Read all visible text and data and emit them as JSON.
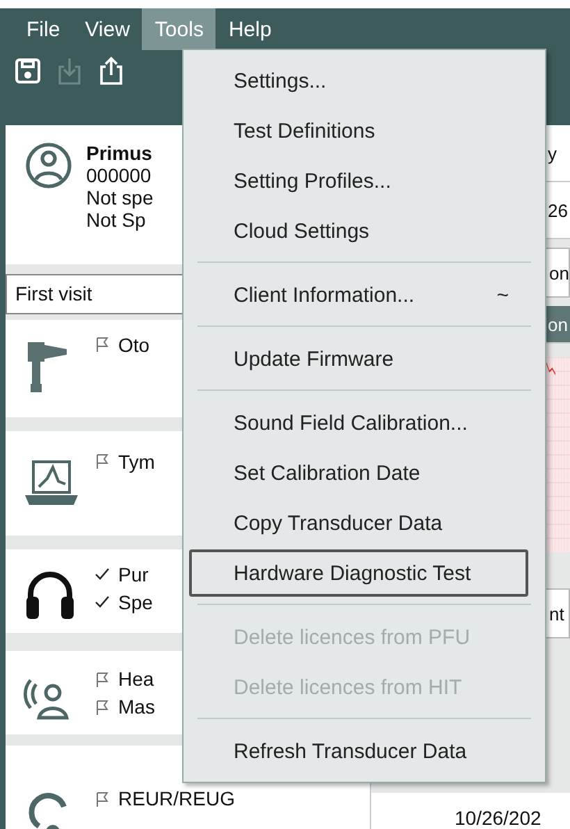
{
  "menubar": [
    {
      "label": "File",
      "selected": false
    },
    {
      "label": "View",
      "selected": false
    },
    {
      "label": "Tools",
      "selected": true
    },
    {
      "label": "Help",
      "selected": false
    }
  ],
  "toolbar": [
    {
      "kind": "save",
      "disabled": false
    },
    {
      "kind": "import",
      "disabled": true
    },
    {
      "kind": "export",
      "disabled": false
    }
  ],
  "client": {
    "name": "Primus",
    "id": "000000",
    "line_3": "Not spe",
    "line_4": "Not Sp"
  },
  "visit": {
    "value": "First visit"
  },
  "tests": [
    {
      "kind": "otoscope",
      "items": [
        {
          "label": "Oto",
          "done": false
        }
      ]
    },
    {
      "kind": "tympanometer",
      "items": [
        {
          "label": "Tym",
          "done": false
        }
      ]
    },
    {
      "kind": "headphones",
      "items": [
        {
          "label": "Pur",
          "done": true
        },
        {
          "label": "Spe",
          "done": true
        }
      ]
    },
    {
      "kind": "speaker",
      "items": [
        {
          "label": "Hea",
          "done": false
        },
        {
          "label": "Mas",
          "done": false
        }
      ]
    },
    {
      "kind": "ear",
      "items": [
        {
          "label": "REUR/REUG",
          "done": false
        }
      ]
    }
  ],
  "right_panel": {
    "rows": [
      {
        "kind": "text",
        "text": "y"
      },
      {
        "kind": "text",
        "text": "26"
      },
      {
        "kind": "field",
        "text": "on"
      },
      {
        "kind": "header",
        "text": "on"
      },
      {
        "kind": "chart"
      },
      {
        "kind": "field",
        "text": "nt"
      }
    ],
    "date": "10/26/202"
  },
  "tools_menu": [
    {
      "kind": "item",
      "label": "Settings...",
      "disabled": false,
      "focused": false
    },
    {
      "kind": "item",
      "label": "Test Definitions",
      "disabled": false,
      "focused": false
    },
    {
      "kind": "item",
      "label": "Setting Profiles...",
      "disabled": false,
      "focused": false
    },
    {
      "kind": "item",
      "label": "Cloud Settings",
      "disabled": false,
      "focused": false
    },
    {
      "kind": "separator"
    },
    {
      "kind": "item",
      "label": "Client Information...",
      "shortcut": "~",
      "disabled": false,
      "focused": false
    },
    {
      "kind": "separator"
    },
    {
      "kind": "item",
      "label": "Update Firmware",
      "disabled": false,
      "focused": false
    },
    {
      "kind": "separator"
    },
    {
      "kind": "item",
      "label": "Sound Field Calibration...",
      "disabled": false,
      "focused": false
    },
    {
      "kind": "item",
      "label": "Set Calibration Date",
      "disabled": false,
      "focused": false
    },
    {
      "kind": "item",
      "label": "Copy Transducer Data",
      "disabled": false,
      "focused": false
    },
    {
      "kind": "item",
      "label": "Hardware Diagnostic Test",
      "disabled": false,
      "focused": true
    },
    {
      "kind": "separator"
    },
    {
      "kind": "item",
      "label": "Delete licences from PFU",
      "disabled": true,
      "focused": false
    },
    {
      "kind": "item",
      "label": "Delete licences from HIT",
      "disabled": true,
      "focused": false
    },
    {
      "kind": "separator"
    },
    {
      "kind": "item",
      "label": "Refresh Transducer Data",
      "disabled": false,
      "focused": false
    }
  ]
}
